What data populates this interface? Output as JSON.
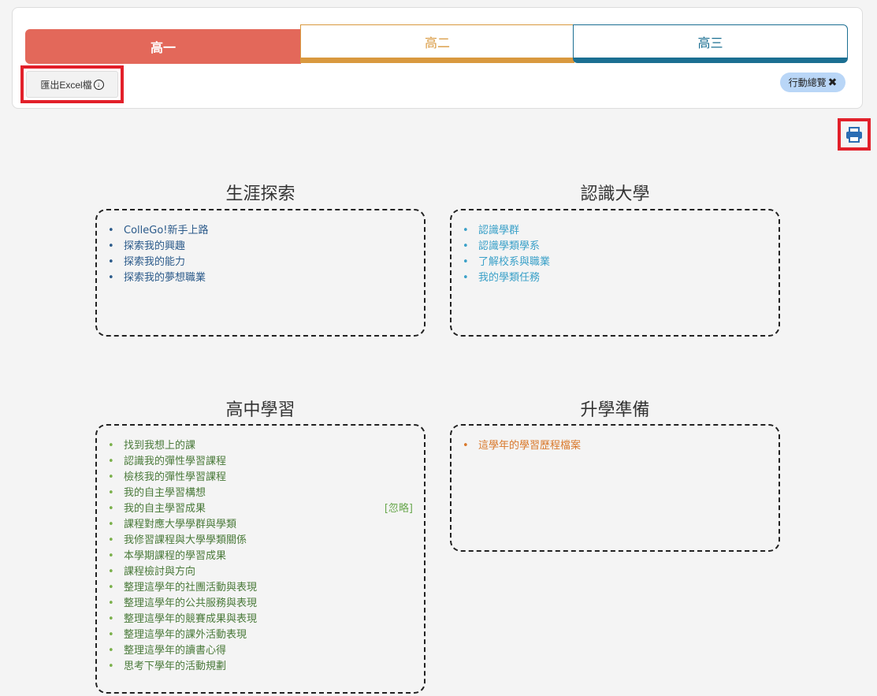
{
  "tabs": [
    {
      "label": "高一"
    },
    {
      "label": "高二"
    },
    {
      "label": "高三"
    }
  ],
  "export_button": {
    "label": "匯出Excel檔",
    "icon": "download-icon"
  },
  "overview_badge": {
    "label": "行動總覽",
    "icon": "close-icon"
  },
  "print_button": {
    "icon": "print-icon"
  },
  "sections": {
    "career": {
      "title": "生涯探索",
      "items": [
        "ColleGo!新手上路",
        "探索我的興趣",
        "探索我的能力",
        "探索我的夢想職業"
      ]
    },
    "university": {
      "title": "認識大學",
      "items": [
        "認識學群",
        "認識學類學系",
        "了解校系與職業",
        "我的學類任務"
      ]
    },
    "highschool": {
      "title": "高中學習",
      "ignore_label": "[忽略]",
      "items": [
        "找到我想上的課",
        "認識我的彈性學習課程",
        "檢核我的彈性學習課程",
        "我的自主學習構想",
        "我的自主學習成果",
        "課程對應大學學群與學類",
        "我修習課程與大學學類關係",
        "本學期課程的學習成果",
        "課程檢討與方向",
        "整理這學年的社團活動與表現",
        "整理這學年的公共服務與表現",
        "整理這學年的競賽成果與表現",
        "整理這學年的課外活動表現",
        "整理這學年的讀書心得",
        "思考下學年的活動規劃"
      ]
    },
    "admission": {
      "title": "升學準備",
      "items": [
        "這學年的學習歷程檔案"
      ]
    }
  },
  "colors": {
    "tab1": "#e3685a",
    "tab2": "#d9993f",
    "tab3": "#1b6f92",
    "highlight": "#e2202a"
  }
}
